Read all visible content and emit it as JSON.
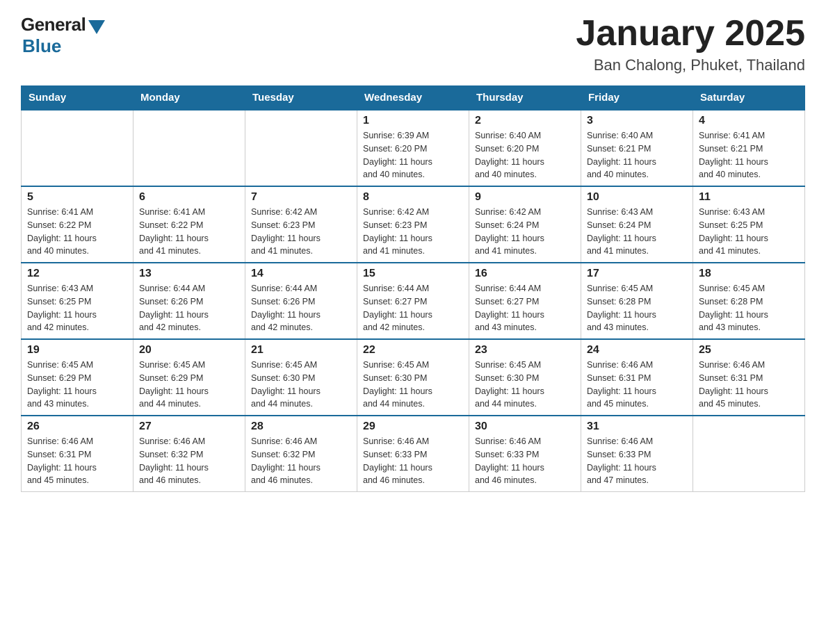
{
  "header": {
    "logo_general": "General",
    "logo_blue": "Blue",
    "month_title": "January 2025",
    "location": "Ban Chalong, Phuket, Thailand"
  },
  "days_of_week": [
    "Sunday",
    "Monday",
    "Tuesday",
    "Wednesday",
    "Thursday",
    "Friday",
    "Saturday"
  ],
  "weeks": [
    [
      {
        "day": "",
        "info": ""
      },
      {
        "day": "",
        "info": ""
      },
      {
        "day": "",
        "info": ""
      },
      {
        "day": "1",
        "info": "Sunrise: 6:39 AM\nSunset: 6:20 PM\nDaylight: 11 hours\nand 40 minutes."
      },
      {
        "day": "2",
        "info": "Sunrise: 6:40 AM\nSunset: 6:20 PM\nDaylight: 11 hours\nand 40 minutes."
      },
      {
        "day": "3",
        "info": "Sunrise: 6:40 AM\nSunset: 6:21 PM\nDaylight: 11 hours\nand 40 minutes."
      },
      {
        "day": "4",
        "info": "Sunrise: 6:41 AM\nSunset: 6:21 PM\nDaylight: 11 hours\nand 40 minutes."
      }
    ],
    [
      {
        "day": "5",
        "info": "Sunrise: 6:41 AM\nSunset: 6:22 PM\nDaylight: 11 hours\nand 40 minutes."
      },
      {
        "day": "6",
        "info": "Sunrise: 6:41 AM\nSunset: 6:22 PM\nDaylight: 11 hours\nand 41 minutes."
      },
      {
        "day": "7",
        "info": "Sunrise: 6:42 AM\nSunset: 6:23 PM\nDaylight: 11 hours\nand 41 minutes."
      },
      {
        "day": "8",
        "info": "Sunrise: 6:42 AM\nSunset: 6:23 PM\nDaylight: 11 hours\nand 41 minutes."
      },
      {
        "day": "9",
        "info": "Sunrise: 6:42 AM\nSunset: 6:24 PM\nDaylight: 11 hours\nand 41 minutes."
      },
      {
        "day": "10",
        "info": "Sunrise: 6:43 AM\nSunset: 6:24 PM\nDaylight: 11 hours\nand 41 minutes."
      },
      {
        "day": "11",
        "info": "Sunrise: 6:43 AM\nSunset: 6:25 PM\nDaylight: 11 hours\nand 41 minutes."
      }
    ],
    [
      {
        "day": "12",
        "info": "Sunrise: 6:43 AM\nSunset: 6:25 PM\nDaylight: 11 hours\nand 42 minutes."
      },
      {
        "day": "13",
        "info": "Sunrise: 6:44 AM\nSunset: 6:26 PM\nDaylight: 11 hours\nand 42 minutes."
      },
      {
        "day": "14",
        "info": "Sunrise: 6:44 AM\nSunset: 6:26 PM\nDaylight: 11 hours\nand 42 minutes."
      },
      {
        "day": "15",
        "info": "Sunrise: 6:44 AM\nSunset: 6:27 PM\nDaylight: 11 hours\nand 42 minutes."
      },
      {
        "day": "16",
        "info": "Sunrise: 6:44 AM\nSunset: 6:27 PM\nDaylight: 11 hours\nand 43 minutes."
      },
      {
        "day": "17",
        "info": "Sunrise: 6:45 AM\nSunset: 6:28 PM\nDaylight: 11 hours\nand 43 minutes."
      },
      {
        "day": "18",
        "info": "Sunrise: 6:45 AM\nSunset: 6:28 PM\nDaylight: 11 hours\nand 43 minutes."
      }
    ],
    [
      {
        "day": "19",
        "info": "Sunrise: 6:45 AM\nSunset: 6:29 PM\nDaylight: 11 hours\nand 43 minutes."
      },
      {
        "day": "20",
        "info": "Sunrise: 6:45 AM\nSunset: 6:29 PM\nDaylight: 11 hours\nand 44 minutes."
      },
      {
        "day": "21",
        "info": "Sunrise: 6:45 AM\nSunset: 6:30 PM\nDaylight: 11 hours\nand 44 minutes."
      },
      {
        "day": "22",
        "info": "Sunrise: 6:45 AM\nSunset: 6:30 PM\nDaylight: 11 hours\nand 44 minutes."
      },
      {
        "day": "23",
        "info": "Sunrise: 6:45 AM\nSunset: 6:30 PM\nDaylight: 11 hours\nand 44 minutes."
      },
      {
        "day": "24",
        "info": "Sunrise: 6:46 AM\nSunset: 6:31 PM\nDaylight: 11 hours\nand 45 minutes."
      },
      {
        "day": "25",
        "info": "Sunrise: 6:46 AM\nSunset: 6:31 PM\nDaylight: 11 hours\nand 45 minutes."
      }
    ],
    [
      {
        "day": "26",
        "info": "Sunrise: 6:46 AM\nSunset: 6:31 PM\nDaylight: 11 hours\nand 45 minutes."
      },
      {
        "day": "27",
        "info": "Sunrise: 6:46 AM\nSunset: 6:32 PM\nDaylight: 11 hours\nand 46 minutes."
      },
      {
        "day": "28",
        "info": "Sunrise: 6:46 AM\nSunset: 6:32 PM\nDaylight: 11 hours\nand 46 minutes."
      },
      {
        "day": "29",
        "info": "Sunrise: 6:46 AM\nSunset: 6:33 PM\nDaylight: 11 hours\nand 46 minutes."
      },
      {
        "day": "30",
        "info": "Sunrise: 6:46 AM\nSunset: 6:33 PM\nDaylight: 11 hours\nand 46 minutes."
      },
      {
        "day": "31",
        "info": "Sunrise: 6:46 AM\nSunset: 6:33 PM\nDaylight: 11 hours\nand 47 minutes."
      },
      {
        "day": "",
        "info": ""
      }
    ]
  ]
}
